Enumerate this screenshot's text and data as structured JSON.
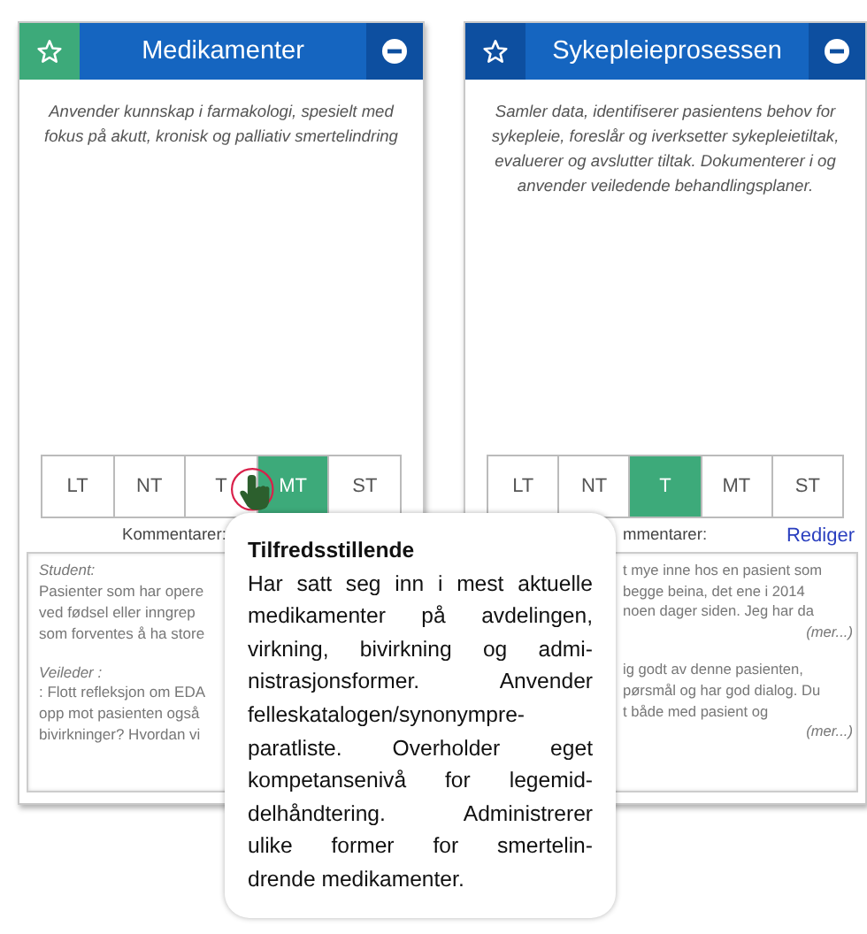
{
  "cards": [
    {
      "title": "Medikamenter",
      "favorite": true,
      "description": "Anvender kunnskap i farmakologi, spesielt med fokus på akutt, kronisk og palliativ smertelindring",
      "ratings": [
        {
          "label": "LT",
          "selected": false
        },
        {
          "label": "NT",
          "selected": false
        },
        {
          "label": "T",
          "selected": false
        },
        {
          "label": "MT",
          "selected": true
        },
        {
          "label": "ST",
          "selected": false
        }
      ],
      "comments_label": "Kommentarer:",
      "comments": [
        {
          "author": "Student:",
          "lines": [
            "Pasienter som har opere",
            "ved fødsel eller inngrep",
            "som forventes å ha store"
          ]
        },
        {
          "author": "Veileder :",
          "lines": [
            ": Flott refleksjon om EDA",
            "opp mot pasienten også",
            "bivirkninger? Hvordan vi"
          ]
        }
      ]
    },
    {
      "title": "Sykepleieprosessen",
      "favorite": false,
      "description": "Samler data, identifiserer pasientens behov for sykepleie, foreslår og iverksetter sykepleietiltak, evaluerer og avslutter tiltak. Dokumenterer i og anvender veiledende behandlingsplaner.",
      "ratings": [
        {
          "label": "LT",
          "selected": false
        },
        {
          "label": "NT",
          "selected": false
        },
        {
          "label": "T",
          "selected": true
        },
        {
          "label": "MT",
          "selected": false
        },
        {
          "label": "ST",
          "selected": false
        }
      ],
      "comments_label": "mmentarer:",
      "edit": "Rediger",
      "comments": [
        {
          "lines": [
            "t mye inne hos en pasient som",
            "begge beina, det ene i 2014",
            "noen dager siden. Jeg har da"
          ],
          "more": "(mer...)"
        },
        {
          "lines": [
            "ig godt av denne pasienten,",
            "pørsmål og har god dialog. Du",
            "t både med pasient og"
          ],
          "more": "(mer...)"
        }
      ]
    }
  ],
  "tooltip": {
    "title": "Tilfredsstillende",
    "lines": [
      "Har satt seg inn i mest aktuelle",
      "medikamenter på avdelingen,",
      "virkning, bivirkning og admi-",
      "nistrasjonsformer. Anvender",
      "felleskatalogen/synonympre-",
      "paratliste. Overholder eget",
      "kompetansenivå for legemid-",
      "delhåndtering. Administrerer",
      "ulike former for smertelin-",
      "drende medikamenter."
    ]
  }
}
